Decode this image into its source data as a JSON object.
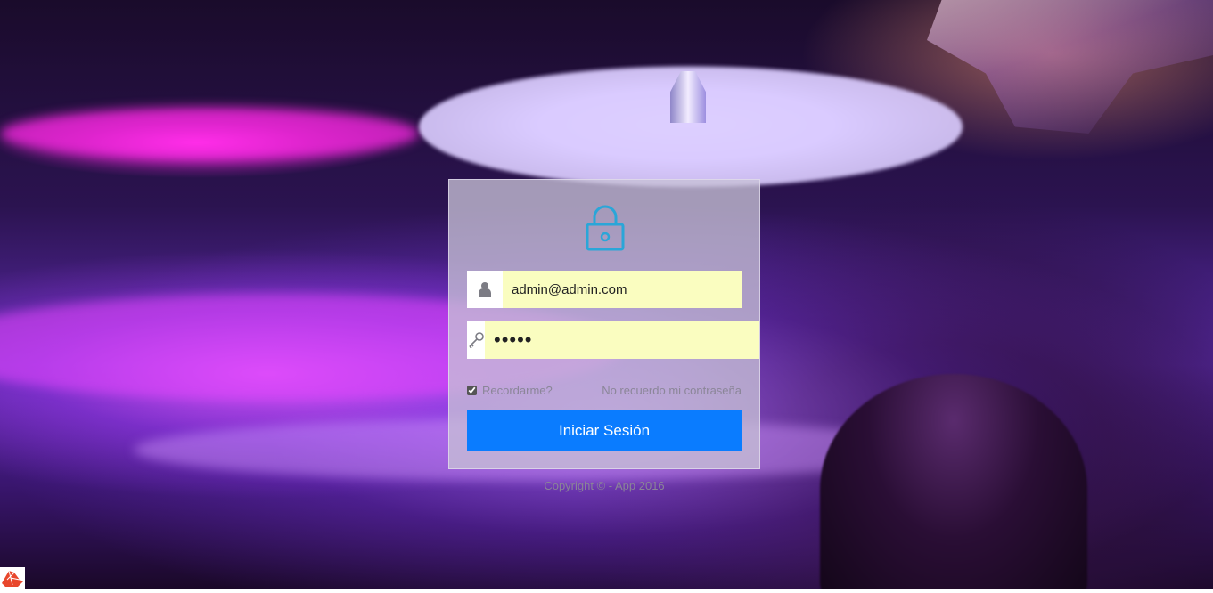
{
  "login": {
    "email_value": "admin@admin.com",
    "password_value": "12345",
    "remember_label": "Recordarme?",
    "forgot_label": "No recuerdo mi contraseña",
    "submit_label": "Iniciar Sesión"
  },
  "footer": {
    "copyright": "Copyright © - App 2016"
  },
  "icons": {
    "lock": "lock-icon",
    "user": "user-icon",
    "key": "key-icon"
  },
  "colors": {
    "accent": "#0a7cff",
    "lock_icon": "#2aa6d8",
    "input_bg": "#fafdc0"
  }
}
